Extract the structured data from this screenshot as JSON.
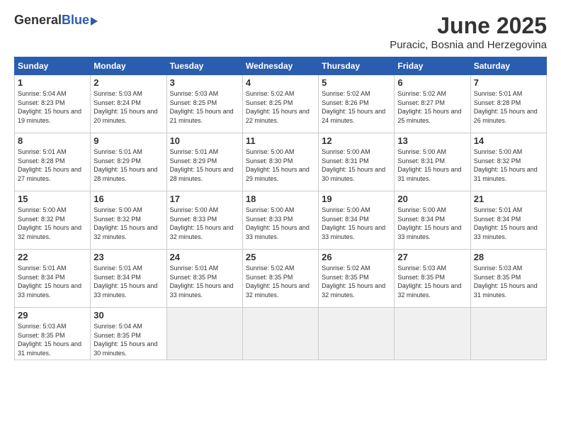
{
  "header": {
    "logo_general": "General",
    "logo_blue": "Blue",
    "month_title": "June 2025",
    "subtitle": "Puracic, Bosnia and Herzegovina"
  },
  "weekdays": [
    "Sunday",
    "Monday",
    "Tuesday",
    "Wednesday",
    "Thursday",
    "Friday",
    "Saturday"
  ],
  "weeks": [
    [
      {
        "day": "1",
        "sunrise": "Sunrise: 5:04 AM",
        "sunset": "Sunset: 8:23 PM",
        "daylight": "Daylight: 15 hours and 19 minutes."
      },
      {
        "day": "2",
        "sunrise": "Sunrise: 5:03 AM",
        "sunset": "Sunset: 8:24 PM",
        "daylight": "Daylight: 15 hours and 20 minutes."
      },
      {
        "day": "3",
        "sunrise": "Sunrise: 5:03 AM",
        "sunset": "Sunset: 8:25 PM",
        "daylight": "Daylight: 15 hours and 21 minutes."
      },
      {
        "day": "4",
        "sunrise": "Sunrise: 5:02 AM",
        "sunset": "Sunset: 8:25 PM",
        "daylight": "Daylight: 15 hours and 22 minutes."
      },
      {
        "day": "5",
        "sunrise": "Sunrise: 5:02 AM",
        "sunset": "Sunset: 8:26 PM",
        "daylight": "Daylight: 15 hours and 24 minutes."
      },
      {
        "day": "6",
        "sunrise": "Sunrise: 5:02 AM",
        "sunset": "Sunset: 8:27 PM",
        "daylight": "Daylight: 15 hours and 25 minutes."
      },
      {
        "day": "7",
        "sunrise": "Sunrise: 5:01 AM",
        "sunset": "Sunset: 8:28 PM",
        "daylight": "Daylight: 15 hours and 26 minutes."
      }
    ],
    [
      {
        "day": "8",
        "sunrise": "Sunrise: 5:01 AM",
        "sunset": "Sunset: 8:28 PM",
        "daylight": "Daylight: 15 hours and 27 minutes."
      },
      {
        "day": "9",
        "sunrise": "Sunrise: 5:01 AM",
        "sunset": "Sunset: 8:29 PM",
        "daylight": "Daylight: 15 hours and 28 minutes."
      },
      {
        "day": "10",
        "sunrise": "Sunrise: 5:01 AM",
        "sunset": "Sunset: 8:29 PM",
        "daylight": "Daylight: 15 hours and 28 minutes."
      },
      {
        "day": "11",
        "sunrise": "Sunrise: 5:00 AM",
        "sunset": "Sunset: 8:30 PM",
        "daylight": "Daylight: 15 hours and 29 minutes."
      },
      {
        "day": "12",
        "sunrise": "Sunrise: 5:00 AM",
        "sunset": "Sunset: 8:31 PM",
        "daylight": "Daylight: 15 hours and 30 minutes."
      },
      {
        "day": "13",
        "sunrise": "Sunrise: 5:00 AM",
        "sunset": "Sunset: 8:31 PM",
        "daylight": "Daylight: 15 hours and 31 minutes."
      },
      {
        "day": "14",
        "sunrise": "Sunrise: 5:00 AM",
        "sunset": "Sunset: 8:32 PM",
        "daylight": "Daylight: 15 hours and 31 minutes."
      }
    ],
    [
      {
        "day": "15",
        "sunrise": "Sunrise: 5:00 AM",
        "sunset": "Sunset: 8:32 PM",
        "daylight": "Daylight: 15 hours and 32 minutes."
      },
      {
        "day": "16",
        "sunrise": "Sunrise: 5:00 AM",
        "sunset": "Sunset: 8:32 PM",
        "daylight": "Daylight: 15 hours and 32 minutes."
      },
      {
        "day": "17",
        "sunrise": "Sunrise: 5:00 AM",
        "sunset": "Sunset: 8:33 PM",
        "daylight": "Daylight: 15 hours and 32 minutes."
      },
      {
        "day": "18",
        "sunrise": "Sunrise: 5:00 AM",
        "sunset": "Sunset: 8:33 PM",
        "daylight": "Daylight: 15 hours and 33 minutes."
      },
      {
        "day": "19",
        "sunrise": "Sunrise: 5:00 AM",
        "sunset": "Sunset: 8:34 PM",
        "daylight": "Daylight: 15 hours and 33 minutes."
      },
      {
        "day": "20",
        "sunrise": "Sunrise: 5:00 AM",
        "sunset": "Sunset: 8:34 PM",
        "daylight": "Daylight: 15 hours and 33 minutes."
      },
      {
        "day": "21",
        "sunrise": "Sunrise: 5:01 AM",
        "sunset": "Sunset: 8:34 PM",
        "daylight": "Daylight: 15 hours and 33 minutes."
      }
    ],
    [
      {
        "day": "22",
        "sunrise": "Sunrise: 5:01 AM",
        "sunset": "Sunset: 8:34 PM",
        "daylight": "Daylight: 15 hours and 33 minutes."
      },
      {
        "day": "23",
        "sunrise": "Sunrise: 5:01 AM",
        "sunset": "Sunset: 8:34 PM",
        "daylight": "Daylight: 15 hours and 33 minutes."
      },
      {
        "day": "24",
        "sunrise": "Sunrise: 5:01 AM",
        "sunset": "Sunset: 8:35 PM",
        "daylight": "Daylight: 15 hours and 33 minutes."
      },
      {
        "day": "25",
        "sunrise": "Sunrise: 5:02 AM",
        "sunset": "Sunset: 8:35 PM",
        "daylight": "Daylight: 15 hours and 32 minutes."
      },
      {
        "day": "26",
        "sunrise": "Sunrise: 5:02 AM",
        "sunset": "Sunset: 8:35 PM",
        "daylight": "Daylight: 15 hours and 32 minutes."
      },
      {
        "day": "27",
        "sunrise": "Sunrise: 5:03 AM",
        "sunset": "Sunset: 8:35 PM",
        "daylight": "Daylight: 15 hours and 32 minutes."
      },
      {
        "day": "28",
        "sunrise": "Sunrise: 5:03 AM",
        "sunset": "Sunset: 8:35 PM",
        "daylight": "Daylight: 15 hours and 31 minutes."
      }
    ],
    [
      {
        "day": "29",
        "sunrise": "Sunrise: 5:03 AM",
        "sunset": "Sunset: 8:35 PM",
        "daylight": "Daylight: 15 hours and 31 minutes."
      },
      {
        "day": "30",
        "sunrise": "Sunrise: 5:04 AM",
        "sunset": "Sunset: 8:35 PM",
        "daylight": "Daylight: 15 hours and 30 minutes."
      },
      {
        "day": "",
        "sunrise": "",
        "sunset": "",
        "daylight": ""
      },
      {
        "day": "",
        "sunrise": "",
        "sunset": "",
        "daylight": ""
      },
      {
        "day": "",
        "sunrise": "",
        "sunset": "",
        "daylight": ""
      },
      {
        "day": "",
        "sunrise": "",
        "sunset": "",
        "daylight": ""
      },
      {
        "day": "",
        "sunrise": "",
        "sunset": "",
        "daylight": ""
      }
    ]
  ]
}
